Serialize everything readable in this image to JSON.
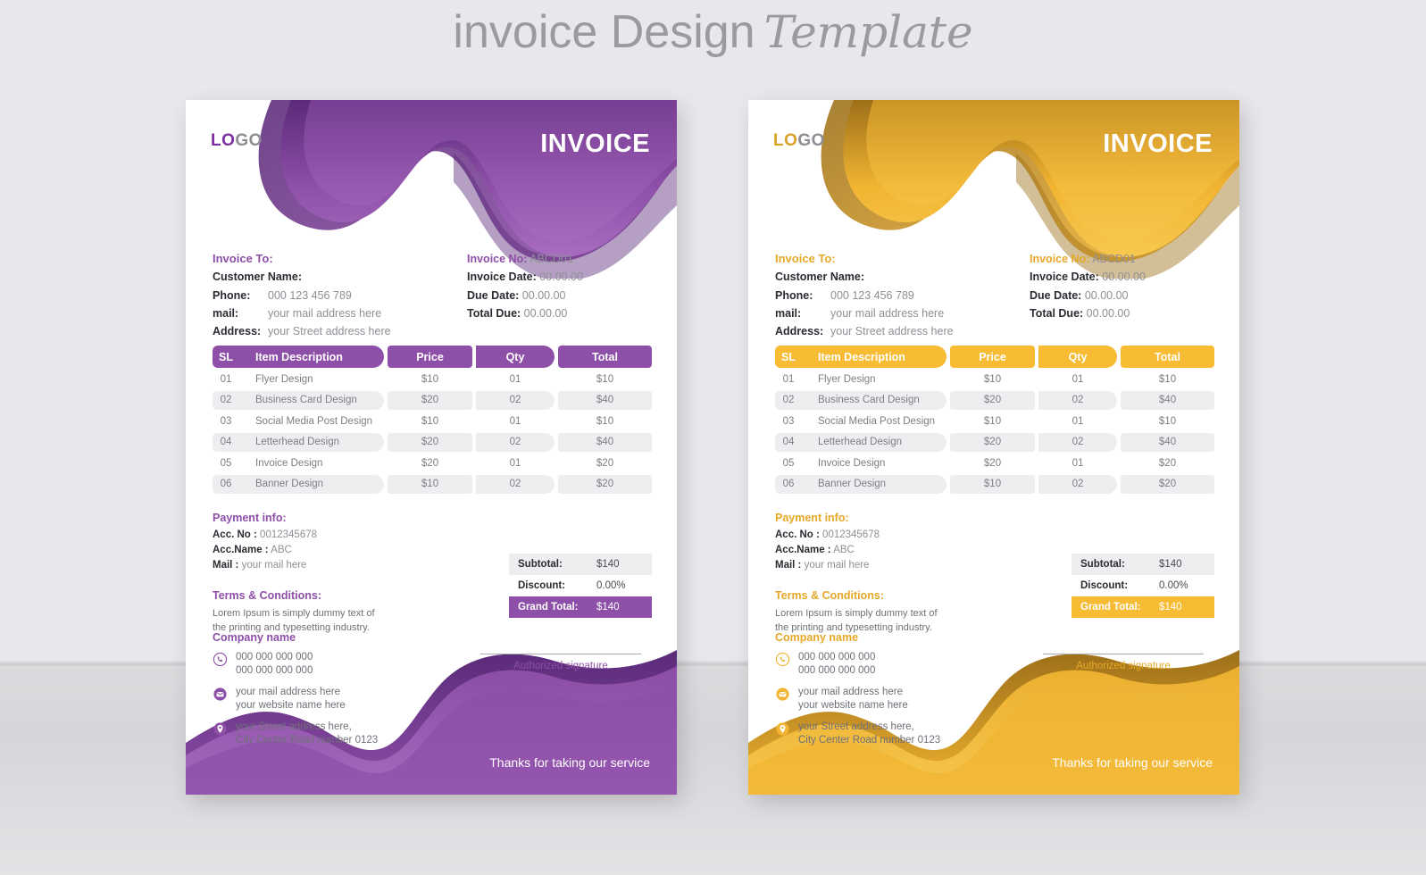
{
  "page": {
    "title_main": "invoice Design",
    "title_script": "Template",
    "background": "#e8e8ec"
  },
  "theme": {
    "purple": {
      "name": "purple",
      "accent": "#8e4fa8",
      "accent_dark": "#5b2a79",
      "accent_light": "#a86cc0",
      "heading": "#8e4fa8",
      "table_header": "#8e4fa8",
      "grand_total_bg": "#8e4fa8",
      "logo_color": "#7b2fa0"
    },
    "gold": {
      "name": "gold",
      "accent": "#f2b431",
      "accent_dark": "#9c6f18",
      "accent_light": "#f7c84f",
      "heading": "#e5a828",
      "table_header": "#f7bb34",
      "grand_total_bg": "#f7bb34",
      "logo_color": "#d9a227"
    }
  },
  "invoice": {
    "logo": {
      "bold_part": "LO",
      "light_part": "GO"
    },
    "title": "INVOICE",
    "bill_to": {
      "heading": "Invoice To:",
      "customer_label": "Customer Name:",
      "phone_label": "Phone:",
      "phone_value": "000 123 456 789",
      "mail_label": "mail:",
      "mail_value": "your mail address here",
      "address_label": "Address:",
      "address_value": "your Street address here"
    },
    "meta": {
      "invoice_no_label": "Invoice No:",
      "invoice_no_value": "ABCD01",
      "invoice_date_label": "Invoice Date:",
      "invoice_date_value": "00.00.00",
      "due_date_label": "Due Date:",
      "due_date_value": "00.00.00",
      "total_due_label": "Total Due:",
      "total_due_value": "00.00.00"
    },
    "table": {
      "columns": [
        "SL",
        "Item Description",
        "Price",
        "Qty",
        "Total"
      ],
      "rows": [
        {
          "sl": "01",
          "item": "Flyer Design",
          "price": "$10",
          "qty": "01",
          "total": "$10"
        },
        {
          "sl": "02",
          "item": "Business Card Design",
          "price": "$20",
          "qty": "02",
          "total": "$40"
        },
        {
          "sl": "03",
          "item": "Social Media Post Design",
          "price": "$10",
          "qty": "01",
          "total": "$10"
        },
        {
          "sl": "04",
          "item": "Letterhead Design",
          "price": "$20",
          "qty": "02",
          "total": "$40"
        },
        {
          "sl": "05",
          "item": "Invoice Design",
          "price": "$20",
          "qty": "01",
          "total": "$20"
        },
        {
          "sl": "06",
          "item": "Banner Design",
          "price": "$10",
          "qty": "02",
          "total": "$20"
        }
      ]
    },
    "payment": {
      "heading": "Payment info:",
      "acc_no_label": "Acc. No :",
      "acc_no_value": "0012345678",
      "acc_name_label": "Acc.Name :",
      "acc_name_value": "ABC",
      "mail_label": "Mail :",
      "mail_value": "your mail here"
    },
    "terms": {
      "heading": "Terms & Conditions:",
      "line1": "Lorem Ipsum is simply dummy text of",
      "line2": "the printing and typesetting industry."
    },
    "totals": {
      "subtotal_label": "Subtotal:",
      "subtotal_value": "$140",
      "discount_label": "Discount:",
      "discount_value": "0.00%",
      "grand_total_label": "Grand Total:",
      "grand_total_value": "$140"
    },
    "company": {
      "name": "Company name",
      "phone_icon": "phone-icon",
      "phone_line1": "000 000 000 000",
      "phone_line2": "000 000 000 000",
      "mail_icon": "mail-icon",
      "mail_line1": "your mail address here",
      "mail_line2": "your website name here",
      "location_icon": "location-pin-icon",
      "address_line1": "your Street address here,",
      "address_line2": "City Center Road number 0123"
    },
    "signature": "Authorized signature",
    "thanks": "Thanks for taking our service"
  }
}
